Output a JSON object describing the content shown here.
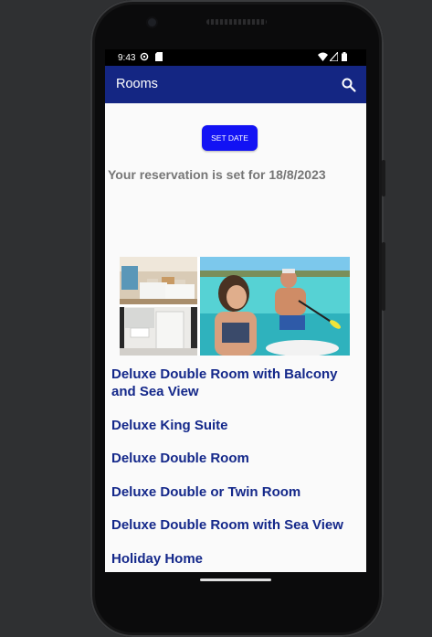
{
  "status_bar": {
    "time": "9:43",
    "left_icons": [
      "settings-icon",
      "sd-card-icon"
    ],
    "right_icons": [
      "wifi-icon",
      "signal-icon",
      "battery-icon"
    ]
  },
  "app_bar": {
    "title": "Rooms",
    "action_icon": "search-icon"
  },
  "booking": {
    "set_date_label": "SET DATE",
    "reservation_text": "Your reservation is set for 18/8/2023"
  },
  "rooms": [
    {
      "name": "Deluxe Double Room with Balcony and Sea View"
    },
    {
      "name": "Deluxe King Suite"
    },
    {
      "name": "Deluxe Double Room"
    },
    {
      "name": "Deluxe Double or Twin Room"
    },
    {
      "name": "Deluxe Double Room with Sea View"
    },
    {
      "name": "Holiday Home"
    }
  ],
  "colors": {
    "app_bar": "#142683",
    "button": "#1212f4",
    "room_title": "#14288a",
    "reservation_text": "#767676"
  }
}
